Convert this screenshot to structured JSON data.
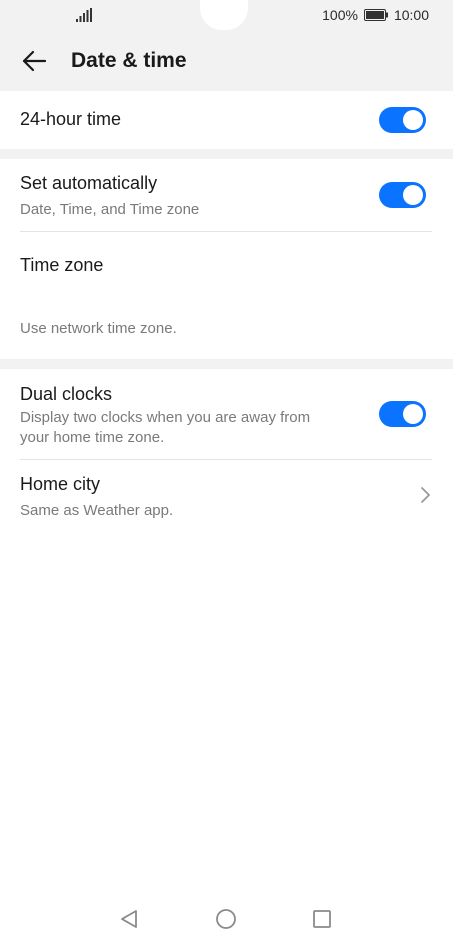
{
  "status_bar": {
    "battery_percent": "100%",
    "time": "10:00",
    "icons": [
      "signal-icon",
      "battery-icon"
    ]
  },
  "header": {
    "back_icon": "arrow-left-icon",
    "title": "Date & time"
  },
  "settings": {
    "hour24": {
      "title": "24-hour time",
      "enabled": true
    },
    "set_automatically": {
      "title": "Set automatically",
      "subtitle": "Date, Time, and Time zone",
      "enabled": true
    },
    "time_zone": {
      "title": "Time zone",
      "subtitle": "Use network time zone."
    },
    "dual_clocks": {
      "title": "Dual clocks",
      "subtitle_line1": "Display two clocks when you are away from",
      "subtitle_line2": "your home time zone.",
      "enabled": true
    },
    "home_city": {
      "title": "Home city",
      "subtitle": "Same as Weather app.",
      "icon": "chevron-right-icon"
    }
  },
  "nav_bar": {
    "icons": [
      "back-triangle-icon",
      "home-circle-icon",
      "recents-square-icon"
    ]
  },
  "colors": {
    "accent": "#0a73ff",
    "background": "#ffffff",
    "band": "#f2f2f2",
    "secondary_text": "#7a7a7a"
  }
}
